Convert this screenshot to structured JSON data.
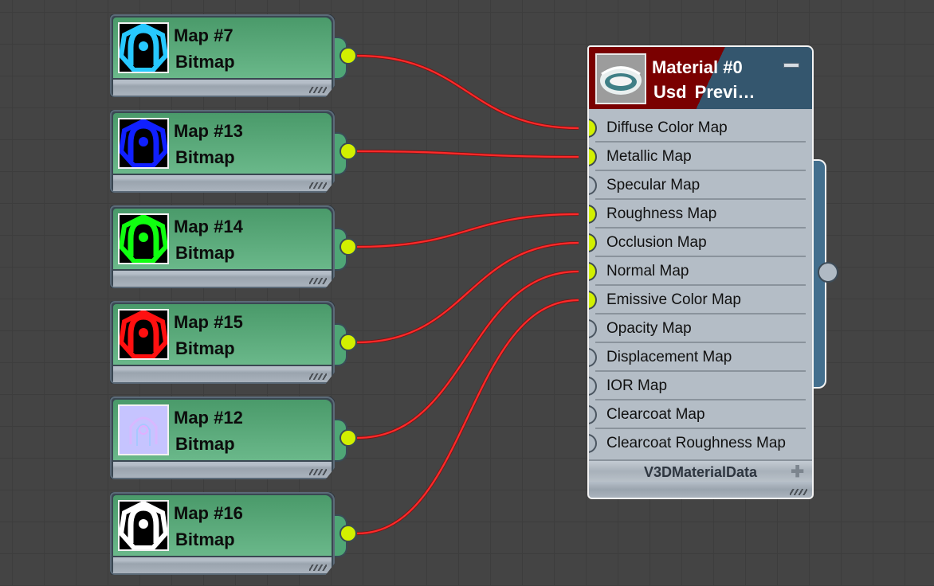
{
  "canvas": {
    "background": "#444444",
    "grid_color": "#3d3d3d"
  },
  "colors": {
    "wire": "#ff2a2a",
    "socket_connected": "#d2f000",
    "socket_empty": "#b0bac4",
    "bitmap_node": "#5aab7b",
    "material_header_left": "#7a0000",
    "material_header_right": "#34566e",
    "material_body": "#b4bdc6"
  },
  "bitmap_nodes": [
    {
      "title": "Map #7",
      "type": "Bitmap",
      "thumb_icon": "texture-thumbnail-icon",
      "thumb_color": "#27c8ff",
      "connects_to": "Diffuse Color Map"
    },
    {
      "title": "Map #13",
      "type": "Bitmap",
      "thumb_icon": "texture-thumbnail-icon",
      "thumb_color": "#1020ff",
      "connects_to": "Metallic Map"
    },
    {
      "title": "Map #14",
      "type": "Bitmap",
      "thumb_icon": "texture-thumbnail-icon",
      "thumb_color": "#10ff10",
      "connects_to": "Roughness Map"
    },
    {
      "title": "Map #15",
      "type": "Bitmap",
      "thumb_icon": "texture-thumbnail-icon",
      "thumb_color": "#ff1010",
      "connects_to": "Occlusion Map"
    },
    {
      "title": "Map #12",
      "type": "Bitmap",
      "thumb_icon": "normal-map-thumbnail-icon",
      "thumb_color": "#c4c4ff",
      "connects_to": "Normal Map"
    },
    {
      "title": "Map #16",
      "type": "Bitmap",
      "thumb_icon": "texture-thumbnail-icon",
      "thumb_color": "#ffffff",
      "connects_to": "Emissive Color Map"
    }
  ],
  "material_node": {
    "title": "Material #0",
    "subtitle": "Usd  Previ…",
    "thumb_icon": "material-preview-icon",
    "collapse_icon": "minus-icon",
    "slots": [
      {
        "label": "Diffuse Color Map",
        "connected": true
      },
      {
        "label": "Metallic Map",
        "connected": true
      },
      {
        "label": "Specular Map",
        "connected": false
      },
      {
        "label": "Roughness Map",
        "connected": true
      },
      {
        "label": "Occlusion Map",
        "connected": true
      },
      {
        "label": "Normal Map",
        "connected": true
      },
      {
        "label": "Emissive Color Map",
        "connected": true
      },
      {
        "label": "Opacity Map",
        "connected": false
      },
      {
        "label": "Displacement Map",
        "connected": false
      },
      {
        "label": "IOR Map",
        "connected": false
      },
      {
        "label": "Clearcoat Map",
        "connected": false
      },
      {
        "label": "Clearcoat Roughness Map",
        "connected": false
      }
    ],
    "rollout_label": "V3DMaterialData",
    "rollout_icon": "plus-icon"
  }
}
